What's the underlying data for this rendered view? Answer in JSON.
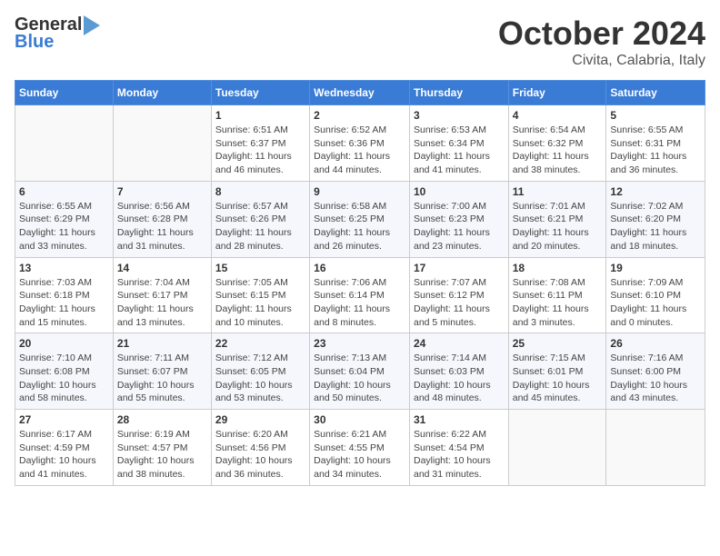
{
  "header": {
    "logo_general": "General",
    "logo_blue": "Blue",
    "title": "October 2024",
    "subtitle": "Civita, Calabria, Italy"
  },
  "calendar": {
    "days_of_week": [
      "Sunday",
      "Monday",
      "Tuesday",
      "Wednesday",
      "Thursday",
      "Friday",
      "Saturday"
    ],
    "weeks": [
      [
        {
          "day": null,
          "info": null
        },
        {
          "day": null,
          "info": null
        },
        {
          "day": "1",
          "info": "Sunrise: 6:51 AM\nSunset: 6:37 PM\nDaylight: 11 hours and 46 minutes."
        },
        {
          "day": "2",
          "info": "Sunrise: 6:52 AM\nSunset: 6:36 PM\nDaylight: 11 hours and 44 minutes."
        },
        {
          "day": "3",
          "info": "Sunrise: 6:53 AM\nSunset: 6:34 PM\nDaylight: 11 hours and 41 minutes."
        },
        {
          "day": "4",
          "info": "Sunrise: 6:54 AM\nSunset: 6:32 PM\nDaylight: 11 hours and 38 minutes."
        },
        {
          "day": "5",
          "info": "Sunrise: 6:55 AM\nSunset: 6:31 PM\nDaylight: 11 hours and 36 minutes."
        }
      ],
      [
        {
          "day": "6",
          "info": "Sunrise: 6:55 AM\nSunset: 6:29 PM\nDaylight: 11 hours and 33 minutes."
        },
        {
          "day": "7",
          "info": "Sunrise: 6:56 AM\nSunset: 6:28 PM\nDaylight: 11 hours and 31 minutes."
        },
        {
          "day": "8",
          "info": "Sunrise: 6:57 AM\nSunset: 6:26 PM\nDaylight: 11 hours and 28 minutes."
        },
        {
          "day": "9",
          "info": "Sunrise: 6:58 AM\nSunset: 6:25 PM\nDaylight: 11 hours and 26 minutes."
        },
        {
          "day": "10",
          "info": "Sunrise: 7:00 AM\nSunset: 6:23 PM\nDaylight: 11 hours and 23 minutes."
        },
        {
          "day": "11",
          "info": "Sunrise: 7:01 AM\nSunset: 6:21 PM\nDaylight: 11 hours and 20 minutes."
        },
        {
          "day": "12",
          "info": "Sunrise: 7:02 AM\nSunset: 6:20 PM\nDaylight: 11 hours and 18 minutes."
        }
      ],
      [
        {
          "day": "13",
          "info": "Sunrise: 7:03 AM\nSunset: 6:18 PM\nDaylight: 11 hours and 15 minutes."
        },
        {
          "day": "14",
          "info": "Sunrise: 7:04 AM\nSunset: 6:17 PM\nDaylight: 11 hours and 13 minutes."
        },
        {
          "day": "15",
          "info": "Sunrise: 7:05 AM\nSunset: 6:15 PM\nDaylight: 11 hours and 10 minutes."
        },
        {
          "day": "16",
          "info": "Sunrise: 7:06 AM\nSunset: 6:14 PM\nDaylight: 11 hours and 8 minutes."
        },
        {
          "day": "17",
          "info": "Sunrise: 7:07 AM\nSunset: 6:12 PM\nDaylight: 11 hours and 5 minutes."
        },
        {
          "day": "18",
          "info": "Sunrise: 7:08 AM\nSunset: 6:11 PM\nDaylight: 11 hours and 3 minutes."
        },
        {
          "day": "19",
          "info": "Sunrise: 7:09 AM\nSunset: 6:10 PM\nDaylight: 11 hours and 0 minutes."
        }
      ],
      [
        {
          "day": "20",
          "info": "Sunrise: 7:10 AM\nSunset: 6:08 PM\nDaylight: 10 hours and 58 minutes."
        },
        {
          "day": "21",
          "info": "Sunrise: 7:11 AM\nSunset: 6:07 PM\nDaylight: 10 hours and 55 minutes."
        },
        {
          "day": "22",
          "info": "Sunrise: 7:12 AM\nSunset: 6:05 PM\nDaylight: 10 hours and 53 minutes."
        },
        {
          "day": "23",
          "info": "Sunrise: 7:13 AM\nSunset: 6:04 PM\nDaylight: 10 hours and 50 minutes."
        },
        {
          "day": "24",
          "info": "Sunrise: 7:14 AM\nSunset: 6:03 PM\nDaylight: 10 hours and 48 minutes."
        },
        {
          "day": "25",
          "info": "Sunrise: 7:15 AM\nSunset: 6:01 PM\nDaylight: 10 hours and 45 minutes."
        },
        {
          "day": "26",
          "info": "Sunrise: 7:16 AM\nSunset: 6:00 PM\nDaylight: 10 hours and 43 minutes."
        }
      ],
      [
        {
          "day": "27",
          "info": "Sunrise: 6:17 AM\nSunset: 4:59 PM\nDaylight: 10 hours and 41 minutes."
        },
        {
          "day": "28",
          "info": "Sunrise: 6:19 AM\nSunset: 4:57 PM\nDaylight: 10 hours and 38 minutes."
        },
        {
          "day": "29",
          "info": "Sunrise: 6:20 AM\nSunset: 4:56 PM\nDaylight: 10 hours and 36 minutes."
        },
        {
          "day": "30",
          "info": "Sunrise: 6:21 AM\nSunset: 4:55 PM\nDaylight: 10 hours and 34 minutes."
        },
        {
          "day": "31",
          "info": "Sunrise: 6:22 AM\nSunset: 4:54 PM\nDaylight: 10 hours and 31 minutes."
        },
        {
          "day": null,
          "info": null
        },
        {
          "day": null,
          "info": null
        }
      ]
    ]
  }
}
